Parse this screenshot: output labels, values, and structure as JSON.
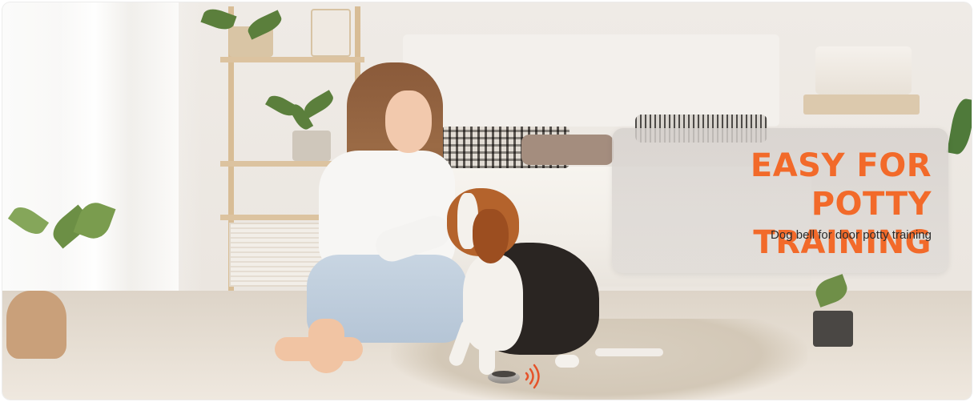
{
  "promo": {
    "title_line_1": "EASY FOR POTTY",
    "title_line_2": "TRAINING",
    "subtitle": "Dog bell for door potty training"
  },
  "colors": {
    "title_accent": "#f26a2a",
    "subtitle_text": "#2b2b2b",
    "panel_background": "#d8d3cf"
  },
  "icons": [
    "signal-waves-icon"
  ]
}
